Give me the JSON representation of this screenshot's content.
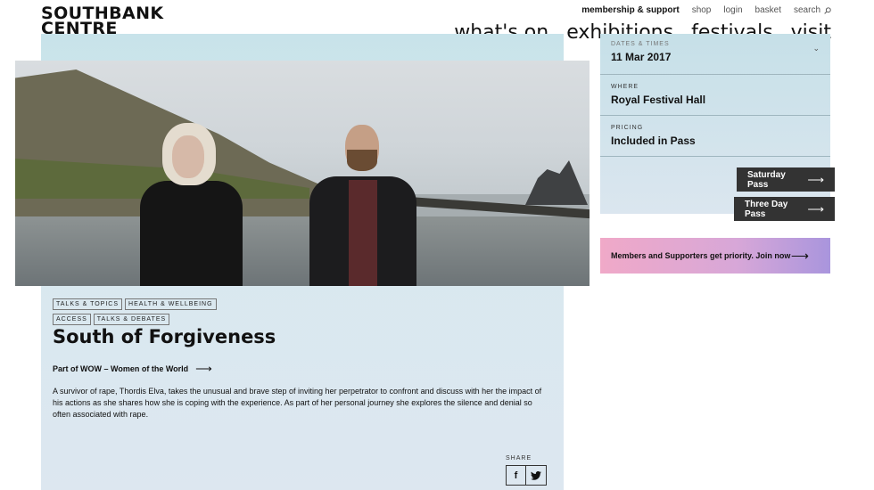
{
  "logo": {
    "line1": "SOUTHBANK",
    "line2": "CENTRE"
  },
  "utility_nav": {
    "membership": "membership & support",
    "shop": "shop",
    "login": "login",
    "basket": "basket",
    "search": "search"
  },
  "main_nav": [
    "what's on",
    "exhibitions",
    "festivals",
    "visit"
  ],
  "event": {
    "dates_label": "DATES & TIMES",
    "date": "11 Mar 2017",
    "where_label": "WHERE",
    "where": "Royal Festival Hall",
    "pricing_label": "PRICING",
    "pricing": "Included in Pass"
  },
  "passes": {
    "saturday": "Saturday Pass",
    "three_day": "Three Day Pass"
  },
  "members_cta": "Members and Supporters get priority. Join now",
  "tags_row1": [
    "TALKS & TOPICS",
    "HEALTH & WELLBEING"
  ],
  "tags_row2": [
    "ACCESS",
    "TALKS & DEBATES"
  ],
  "title": "South of Forgiveness",
  "part_of": "Part of WOW – Women of the World",
  "description": "A survivor of rape, Thordis Elva, takes the unusual and brave step of inviting her perpetrator to confront and discuss with her the impact of his actions as she shares how she is coping with the experience. As part of her personal journey she explores the silence and denial so often associated with rape.",
  "share": {
    "label": "SHARE",
    "facebook": "f",
    "twitter": "t"
  },
  "colors": {
    "panel": "#d0e6ec",
    "button_dark": "#333333",
    "members_gradient": [
      "#f0a9c8",
      "#a995dd"
    ]
  },
  "icons": {
    "search": "search-icon",
    "arrow": "arrow-right-icon",
    "chevron": "chevron-down-icon"
  }
}
